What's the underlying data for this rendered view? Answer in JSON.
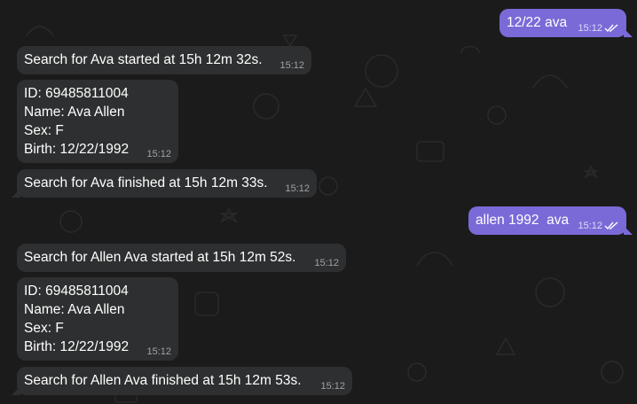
{
  "messages": [
    {
      "dir": "out",
      "text": "12/22 ava",
      "time": "15:12",
      "status": "read-double-check-icon"
    },
    {
      "dir": "in",
      "text": "Search for Ava started at 15h 12m 32s.",
      "time": "15:12"
    },
    {
      "dir": "in",
      "text": "ID: 69485811004\nName: Ava Allen\nSex: F\nBirth: 12/22/1992",
      "time": "15:12"
    },
    {
      "dir": "in",
      "text": "Search for Ava finished at 15h 12m 33s.",
      "time": "15:12"
    },
    {
      "dir": "out",
      "text": "allen 1992  ava",
      "time": "15:12",
      "status": "read-double-check-icon"
    },
    {
      "dir": "in",
      "text": "Search for Allen Ava started at 15h 12m 52s.",
      "time": "15:12"
    },
    {
      "dir": "in",
      "text": "ID: 69485811004\nName: Ava Allen\nSex: F\nBirth: 12/22/1992",
      "time": "15:12"
    },
    {
      "dir": "in",
      "text": "Search for Allen Ava finished at 15h 12m 53s.",
      "time": "15:12"
    }
  ],
  "colors": {
    "background": "#1b1b1c",
    "incoming_bubble": "#2e2f30",
    "outgoing_bubble": "#7a6ad8"
  }
}
